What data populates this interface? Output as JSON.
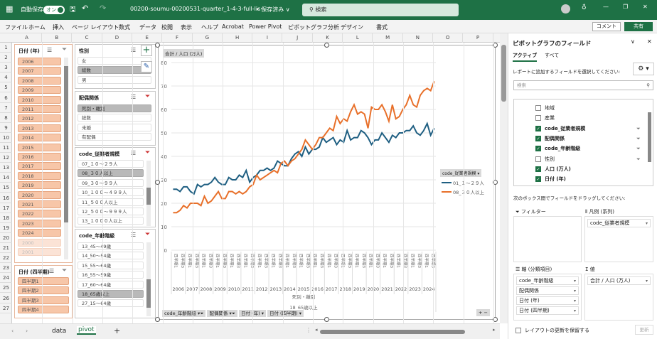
{
  "titlebar": {
    "autosave_label": "自動保存",
    "autosave_state": "オン",
    "filename": "00200-soumu-00200531-quarter_1-4-3-full-lis···",
    "save_status": "• 保存済み ∨",
    "search_placeholder": "検索",
    "accent": "#1e7145"
  },
  "menu": {
    "items": [
      "ファイル",
      "ホーム",
      "挿入",
      "ページ レイアウト",
      "数式",
      "データ",
      "校閲",
      "表示",
      "ヘルプ",
      "Acrobat",
      "Power Pivot",
      "ピボットグラフ分析",
      "デザイン",
      "書式"
    ],
    "comment": "コメント",
    "share": "共有"
  },
  "columns": [
    "A",
    "B",
    "C",
    "D",
    "E",
    "F",
    "G",
    "H",
    "I",
    "J",
    "K",
    "L",
    "M",
    "N",
    "O",
    "P"
  ],
  "rows": [
    "1",
    "2",
    "3",
    "4",
    "5",
    "6",
    "7",
    "8",
    "9",
    "10",
    "11",
    "12",
    "13",
    "14",
    "15",
    "16",
    "17",
    "18",
    "19",
    "20",
    "21",
    "22",
    "23",
    "24",
    "25",
    "26",
    "27"
  ],
  "slicers": {
    "year": {
      "title": "日付 (年)",
      "items": [
        "2006",
        "2007",
        "2008",
        "2009",
        "2010",
        "2011",
        "2012",
        "2013",
        "2014",
        "2015",
        "2016",
        "2017",
        "2018",
        "2019",
        "2020",
        "2021",
        "2022",
        "2023",
        "2024"
      ],
      "dim_items": [
        "2000",
        "2001"
      ]
    },
    "quarter": {
      "title": "日付 (四半期)",
      "items": [
        "四半期1",
        "四半期2",
        "四半期3",
        "四半期4"
      ]
    },
    "sex": {
      "title": "性別",
      "items": [
        "女",
        "総数",
        "男"
      ],
      "selected": "総数"
    },
    "marital": {
      "title": "配偶関係",
      "items": [
        "死別・離別",
        "総数",
        "未婚",
        "有配偶"
      ],
      "selected": "死別・離別"
    },
    "size": {
      "title": "code_従業者規模",
      "items": [
        "07_１０～２９人",
        "08_３０人以上",
        "09_３０～９９人",
        "10_１００～４９９人",
        "11_５００人以上",
        "12_５００～９９９人",
        "13_１０００人以上"
      ],
      "selected": "08_３０人以上"
    },
    "age": {
      "title": "code_年齢階級",
      "items": [
        "13_45～49歳",
        "14_50～54歳",
        "15_55～64歳",
        "16_55～59歳",
        "17_60～64歳",
        "18_65歳以上",
        "27_15～64歳"
      ],
      "selected": "18_65歳以上"
    }
  },
  "chart_data": {
    "type": "line",
    "title": "",
    "value_field_button": "合計 / 人口 (万人)",
    "ylim": [
      0,
      80
    ],
    "yticks": [
      0,
      10,
      20,
      30,
      40,
      50,
      60,
      70,
      80
    ],
    "grid": true,
    "legend_title": "code_従業者規模",
    "legend_position": "right",
    "years": [
      "2006",
      "2007",
      "2008",
      "2009",
      "2010",
      "2011",
      "2012",
      "2013",
      "2014",
      "2015",
      "2016",
      "2017",
      "2018",
      "2019",
      "2020",
      "2021",
      "2022",
      "2023",
      "2024"
    ],
    "quarters": [
      "四半期1",
      "四半期2",
      "四半期3",
      "四半期4"
    ],
    "outer_labels": [
      "死別・離別",
      "18_65歳以上"
    ],
    "series": [
      {
        "name": "01_１～２９人",
        "color": "#1f5f82",
        "values": [
          26,
          26,
          25,
          27,
          27,
          25,
          24,
          28,
          27,
          28,
          28,
          29,
          31,
          29,
          28,
          28,
          31,
          30,
          30,
          32,
          31,
          34,
          29,
          31,
          32,
          34,
          34,
          35,
          34,
          35,
          38,
          37,
          36,
          36,
          39,
          41,
          42,
          40,
          44,
          41,
          43,
          43,
          44,
          48,
          46,
          47,
          48,
          45,
          47,
          46,
          51,
          47,
          48,
          48,
          51,
          50,
          48,
          45,
          47,
          47,
          50,
          48,
          46,
          49,
          48,
          50,
          50,
          51,
          51,
          53,
          50,
          49,
          51,
          54,
          49,
          52
        ]
      },
      {
        "name": "08_３０人以上",
        "color": "#e8702a",
        "values": [
          16,
          16,
          17,
          19,
          18,
          20,
          20,
          20,
          19,
          23,
          20,
          21,
          23,
          25,
          22,
          22,
          25,
          25,
          24,
          25,
          24,
          25,
          27,
          28,
          32,
          30,
          31,
          32,
          33,
          34,
          33,
          37,
          38,
          36,
          38,
          39,
          41,
          43,
          47,
          45,
          43,
          45,
          48,
          48,
          50,
          52,
          51,
          57,
          54,
          56,
          55,
          59,
          62,
          58,
          59,
          58,
          52,
          61,
          60,
          60,
          62,
          59,
          55,
          62,
          56,
          57,
          60,
          62,
          66,
          62,
          61,
          66,
          68,
          69,
          68,
          72
        ]
      }
    ],
    "field_buttons": [
      "code_年齢階級",
      "配偶関係",
      "日付 (年)",
      "日付 (四半期)"
    ]
  },
  "pane": {
    "title": "ピボットグラフのフィールド",
    "tabs": [
      "アクティブ",
      "すべて"
    ],
    "instruction": "レポートに追加するフィールドを選択してください:",
    "search_placeholder": "検索",
    "fields": [
      {
        "label": "地域",
        "checked": false
      },
      {
        "label": "産業",
        "checked": false
      },
      {
        "label": "code_従業者規模",
        "checked": true
      },
      {
        "label": "配偶関係",
        "checked": true
      },
      {
        "label": "code_年齢階級",
        "checked": true
      },
      {
        "label": "性別",
        "checked": false
      },
      {
        "label": "人口 (万人)",
        "checked": true
      },
      {
        "label": "日付 (年)",
        "checked": true
      }
    ],
    "drag_hint": "次のボックス間でフィールドをドラッグしてください:",
    "filters_label": "フィルター",
    "legend_label": "凡例 (系列)",
    "axis_label": "軸 (分類項目)",
    "values_label": "値",
    "legend_items": [
      "code_従業者規模"
    ],
    "axis_items": [
      "code_年齢階級",
      "配偶関係",
      "日付 (年)",
      "日付 (四半期)"
    ],
    "values_items": [
      "合計 / 人口 (万人)"
    ],
    "defer_label": "レイアウトの更新を保留する",
    "update_label": "更新"
  },
  "sheets": {
    "tabs": [
      "data",
      "pivot"
    ],
    "active": "pivot"
  }
}
